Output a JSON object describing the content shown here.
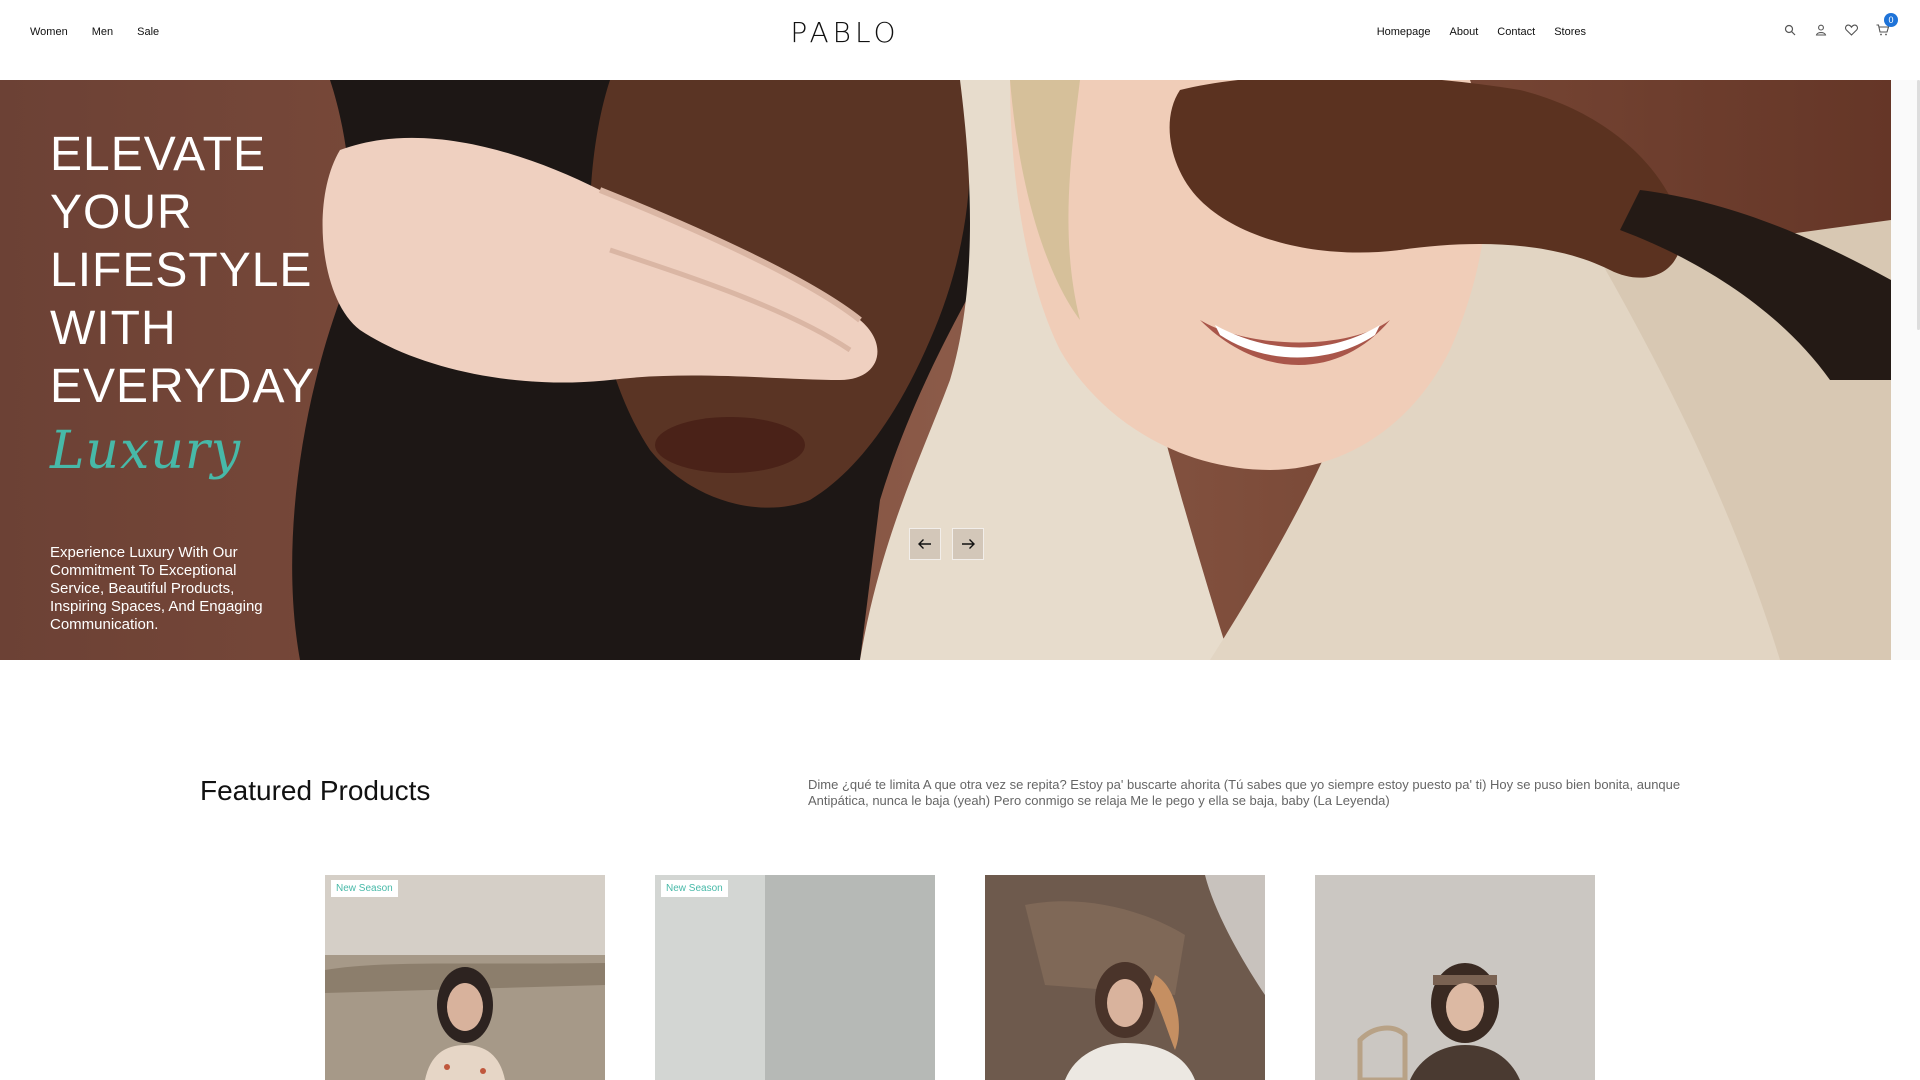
{
  "header": {
    "nav_left": [
      "Women",
      "Men",
      "Sale"
    ],
    "logo": "PABLO",
    "nav_right": [
      "Homepage",
      "About",
      "Contact",
      "Stores"
    ],
    "icons": [
      "search-icon",
      "user-icon",
      "heart-icon",
      "cart-icon"
    ],
    "cart_count": "0"
  },
  "hero": {
    "title_lines": [
      "ELEVATE",
      "YOUR",
      "LIFESTYLE",
      "WITH",
      "EVERYDAY"
    ],
    "accent": "Luxury",
    "description": "Experience Luxury With Our Commitment To Exceptional Service, Beautiful Products, Inspiring Spaces, And Engaging Communication.",
    "accent_color": "#47b9a8"
  },
  "featured": {
    "title": "Featured Products",
    "description": "Dime ¿qué te limita A que otra vez se repita? Estoy pa' buscarte ahorita (Tú sabes que yo siempre estoy puesto pa' ti) Hoy se puso bien bonita, aunque Antipática, nunca le baja (yeah) Pero conmigo se relaja Me le pego y ella se baja, baby (La Leyenda)",
    "products": [
      {
        "badge": "New Season"
      },
      {
        "badge": "New Season"
      },
      {
        "badge": ""
      },
      {
        "badge": ""
      }
    ]
  }
}
